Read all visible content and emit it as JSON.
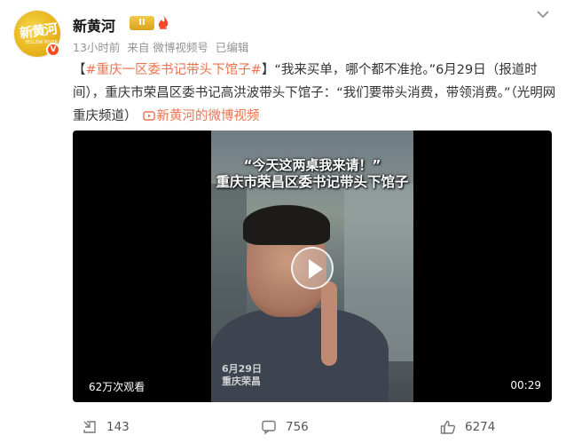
{
  "post": {
    "author": {
      "name": "新黄河",
      "avatar_text": "新黄河",
      "avatar_sub": "YELLOW RIVER",
      "verify_mark": "V",
      "badge_text": "II"
    },
    "meta": {
      "time": "13小时前",
      "source": "来自 微博视频号",
      "edited": "已编辑"
    },
    "content": {
      "bracket_open": "【",
      "hashtag": "#重庆一区委书记带头下馆子#",
      "bracket_close": "】",
      "body": "“我来买单，哪个都不准抢。”6月29日（报道时间），重庆市荣昌区委书记高洪波带头下馆子：“我们要带头消费，带领消费。”（光明网重庆频道）",
      "video_link_text": "新黄河的微博视频"
    },
    "video": {
      "caption_top": "“今天这两桌我来请！”",
      "caption_bottom": "重庆市荣昌区委书记带头下馆子",
      "stamp_date": "6月29日",
      "stamp_place": "重庆荣昌",
      "views": "62万次观看",
      "duration": "00:29"
    },
    "actions": {
      "repost_count": "143",
      "comment_count": "756",
      "like_count": "6274"
    }
  },
  "colors": {
    "link": "#eb7350",
    "meta": "#939393",
    "verify": "#f94b1c"
  }
}
